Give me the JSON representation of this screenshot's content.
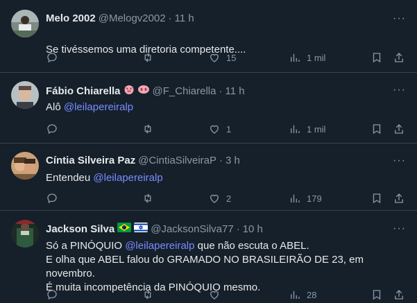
{
  "tweets": [
    {
      "name": "Melo 2002",
      "handle": "@Melogv2002",
      "time": "11 h",
      "body": [
        "Se tivéssemos uma diretoria competente...."
      ],
      "mentions": [],
      "likes": "15",
      "views": "1 mil",
      "avatar_color": "#6b7a70"
    },
    {
      "name": "Fábio Chiarella",
      "handle": "@F_Chiarella",
      "time": "11 h",
      "body_prefix": "Alô ",
      "mention": "@leilapereiralp",
      "body_suffix": "",
      "likes": "1",
      "views": "1 mil",
      "avatar_color": "#9aa2a8"
    },
    {
      "name": "Cíntia Silveira Paz",
      "handle": "@CintiaSilveiraP",
      "time": "3 h",
      "body_prefix": "Entendeu ",
      "mention": "@leilapereiralp",
      "body_suffix": "",
      "likes": "2",
      "views": "179",
      "avatar_color": "#8a6a4a"
    },
    {
      "name": "Jackson Silva",
      "handle": "@JacksonSilva77",
      "time": "10 h",
      "body_prefix": "Só a PINÓQUIO ",
      "mention": "@leilapereiralp",
      "body_suffix": " que não escuta o ABEL.",
      "line2": "E olha que ABEL falou do GRAMADO NO BRASILEIRÃO DE 23, em novembro.",
      "line3": "É muita incompetência da PINÓQUIO mesmo.",
      "views": "28",
      "avatar_color": "#2f4a3a"
    }
  ],
  "icons": {
    "reply": "reply-icon",
    "retweet": "retweet-icon",
    "like": "like-icon",
    "views": "views-icon",
    "bookmark": "bookmark-icon",
    "share": "share-icon"
  },
  "colors": {
    "background": "#15202b",
    "text": "#e7e9ea",
    "muted": "#8b98a5",
    "mention": "#7a8cff",
    "divider": "#38444d"
  }
}
